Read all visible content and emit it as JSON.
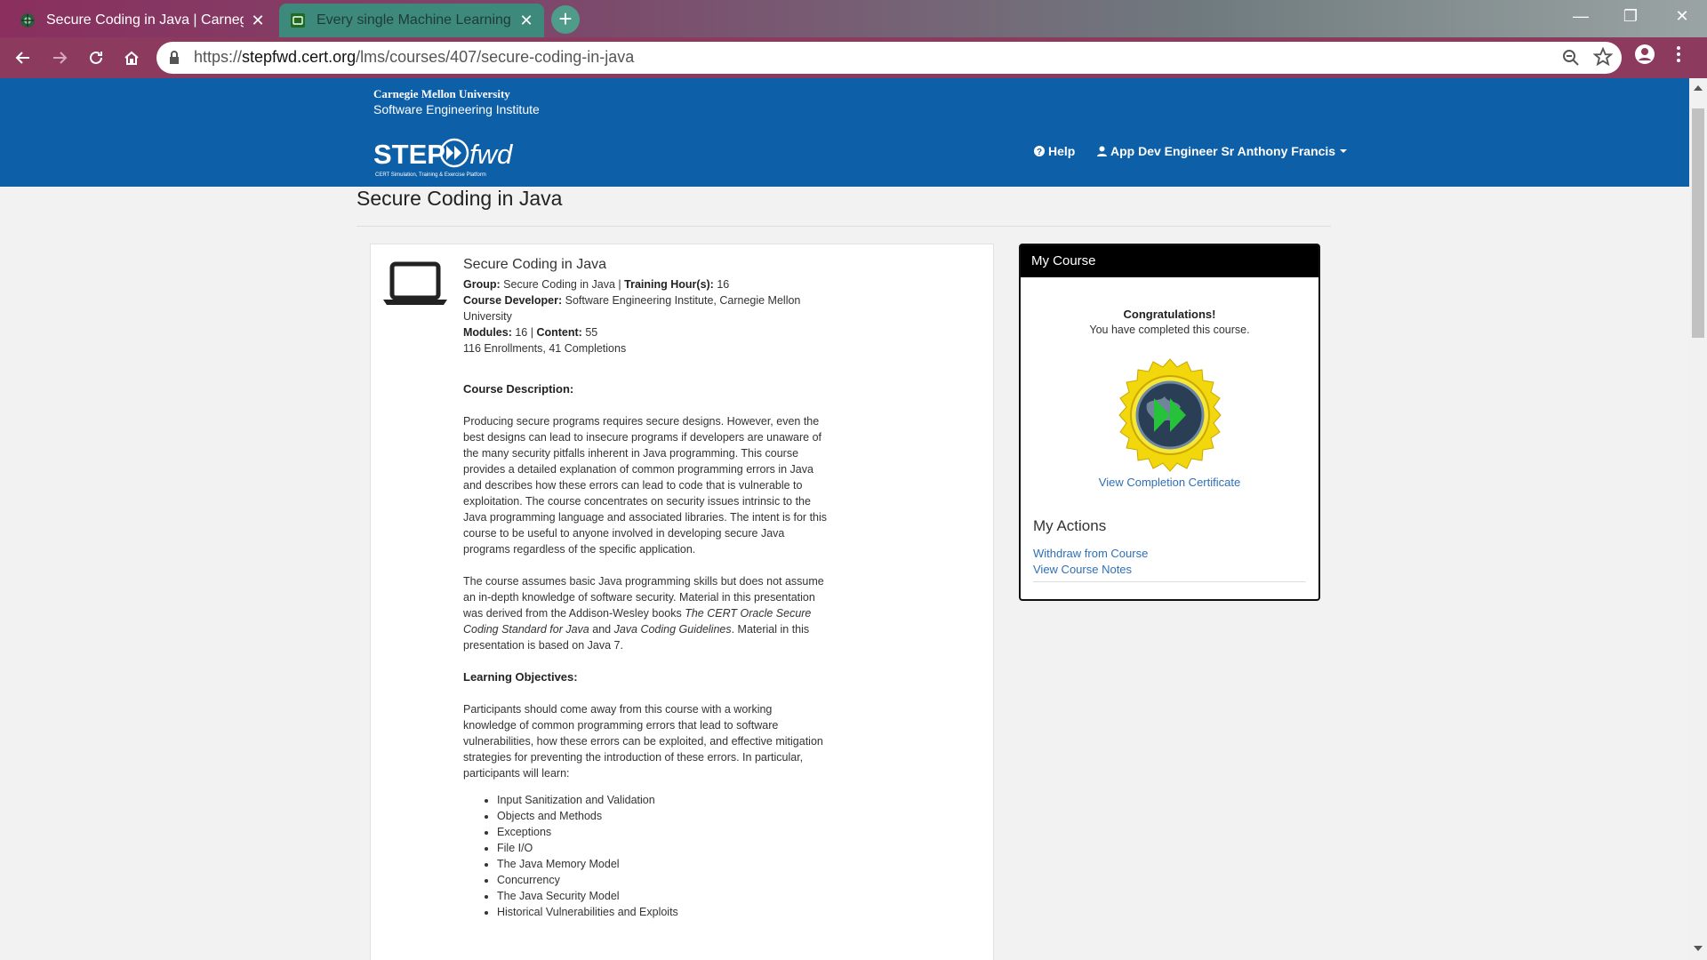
{
  "browser": {
    "tabs": [
      {
        "title": "Secure Coding in Java | Carnegie"
      },
      {
        "title": "Every single Machine Learning co"
      }
    ],
    "new_tab": "+",
    "url": {
      "scheme": "https://",
      "host": "stepfwd.cert.org",
      "path": "/lms/courses/407/secure-coding-in-java"
    }
  },
  "header": {
    "cmu": "Carnegie Mellon University",
    "sei": "Software Engineering Institute",
    "logo_step": "STEP",
    "logo_fwd": "fwd",
    "logo_tagline": "CERT Simulation, Training & Exercise Platform",
    "help": "Help",
    "user": "App Dev Engineer Sr Anthony Francis"
  },
  "page": {
    "title": "Secure Coding in Java"
  },
  "course": {
    "name": "Secure Coding in Java",
    "group_label": "Group:",
    "group": "Secure Coding in Java",
    "sep": "|",
    "hours_label": "Training Hour(s):",
    "hours": "16",
    "developer_label": "Course Developer:",
    "developer": "Software Engineering Institute, Carnegie Mellon University",
    "modules_label": "Modules:",
    "modules": "16",
    "content_label": "Content:",
    "content": "55",
    "stats": "116 Enrollments, 41 Completions",
    "desc_heading": "Course Description:",
    "desc_p1": "Producing secure programs requires secure designs. However, even the best designs can lead to insecure programs if developers are unaware of the many security pitfalls inherent in Java programming. This course provides a detailed explanation of common programming errors in Java and describes how these errors can lead to code that is vulnerable to exploitation. The course concentrates on security issues intrinsic to the Java programming language and associated libraries. The intent is for this course to be useful to anyone involved in developing secure Java programs regardless of the specific application.",
    "desc_p2_a": "The course assumes basic Java programming skills but does not assume an in-depth knowledge of software security. Material in this presentation was derived from the Addison-Wesley books ",
    "desc_p2_book1": "The CERT Oracle Secure Coding Standard for Java",
    "desc_p2_and": " and ",
    "desc_p2_book2": "Java Coding Guidelines",
    "desc_p2_b": ". Material in this presentation is based on Java 7.",
    "obj_heading": "Learning Objectives:",
    "obj_p": "Participants should come away from this course with a working knowledge of common programming errors that lead to software vulnerabilities, how these errors can be exploited, and effective mitigation strategies for preventing the introduction of these errors. In particular, participants will learn:",
    "objectives": [
      "Input Sanitization and Validation",
      "Objects and Methods",
      "Exceptions",
      "File I/O",
      "The Java Memory Model",
      "Concurrency",
      "The Java Security Model",
      "Historical Vulnerabilities and Exploits"
    ]
  },
  "sidebar": {
    "title": "My Course",
    "congrats": "Congratulations!",
    "completed": "You have completed this course.",
    "certificate_link": "View Completion Certificate",
    "actions_title": "My Actions",
    "withdraw": "Withdraw from Course",
    "notes": "View Course Notes"
  },
  "colors": {
    "header": "#0d5fa8",
    "link": "#2f6fb5",
    "toolbar": "#8c3b5f"
  }
}
